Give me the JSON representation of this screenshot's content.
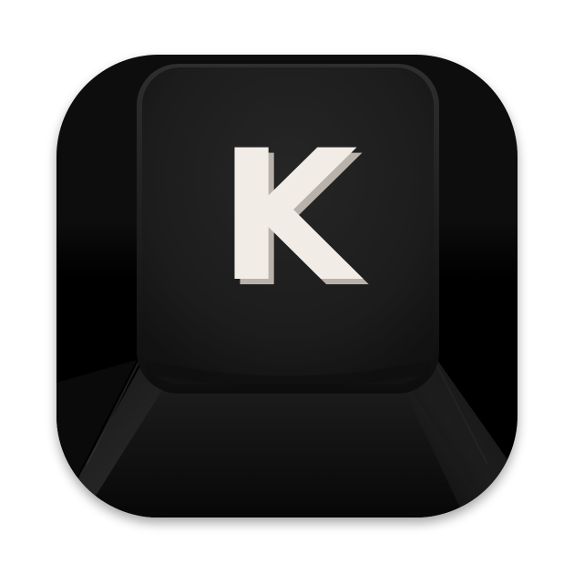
{
  "app_icon": {
    "keycap_legend": "K",
    "colors": {
      "background": "#ffffff",
      "body_dark": "#050505",
      "body_mid": "#141414",
      "top_face": "#1e1e1e",
      "top_face_edge": "#0b0b0b",
      "legend": "#f1ece6",
      "legend_shadow": "#b9b2aa"
    }
  }
}
